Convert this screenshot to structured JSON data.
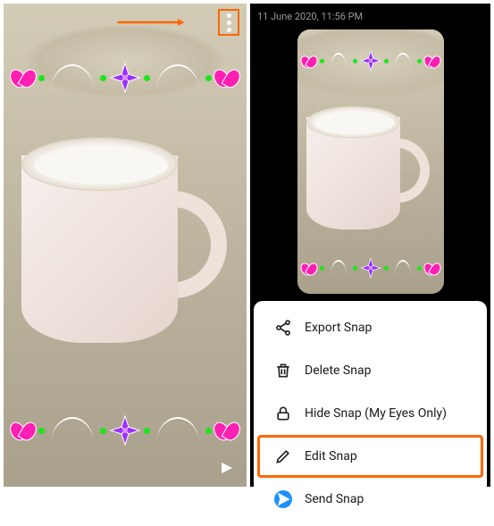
{
  "left": {
    "annotation": {
      "arrow_color": "#ff6600",
      "highlight_target": "more-options"
    }
  },
  "right": {
    "timestamp": "11 June 2020, 11:56 PM",
    "menu": {
      "items": [
        {
          "icon": "share-icon",
          "label": "Export Snap",
          "highlighted": false
        },
        {
          "icon": "trash-icon",
          "label": "Delete Snap",
          "highlighted": false
        },
        {
          "icon": "lock-icon",
          "label": "Hide Snap (My Eyes Only)",
          "highlighted": false
        },
        {
          "icon": "pencil-icon",
          "label": "Edit Snap",
          "highlighted": true
        },
        {
          "icon": "send-icon",
          "label": "Send Snap",
          "highlighted": false
        }
      ]
    }
  },
  "colors": {
    "highlight": "#ff6600",
    "accent_flower": "#9b30ff",
    "accent_lotus": "#ff1fb3",
    "accent_dot": "#1ae61a",
    "send_blue": "#1e90ff"
  }
}
